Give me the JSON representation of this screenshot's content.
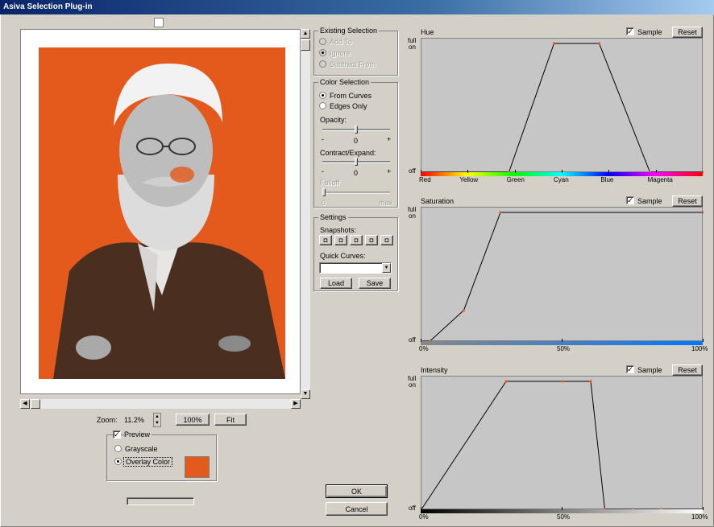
{
  "window": {
    "title": "Asiva Selection Plug-in"
  },
  "preview": {
    "zoom_label": "Zoom:",
    "zoom_value": "11.2%",
    "zoom_100": "100%",
    "zoom_fit": "Fit",
    "preview_label": "Preview",
    "preview_checked": true,
    "grayscale_label": "Grayscale",
    "overlay_label": "Overlay Color",
    "overlay_color": "#e35a1c"
  },
  "existing_selection": {
    "title": "Existing Selection",
    "add_to": "Add To",
    "ignore": "Ignore",
    "subtract_from": "Subtract From"
  },
  "color_selection": {
    "title": "Color Selection",
    "from_curves": "From Curves",
    "edges_only": "Edges Only",
    "opacity_label": "Opacity:",
    "opacity_value": "0",
    "contract_label": "Contract/Expand:",
    "contract_value": "0",
    "falloff_label": "Falloff",
    "falloff_min": "0",
    "falloff_max": "max",
    "minus": "-",
    "plus": "+"
  },
  "settings": {
    "title": "Settings",
    "snapshots_label": "Snapshots:",
    "quick_curves_label": "Quick Curves:",
    "load": "Load",
    "save": "Save"
  },
  "dialog": {
    "ok": "OK",
    "cancel": "Cancel"
  },
  "curves": {
    "sample_label": "Sample",
    "reset_label": "Reset",
    "full_label": "full",
    "on_label": "on",
    "off_label": "off"
  },
  "chart_data": [
    {
      "type": "line",
      "title": "Hue",
      "x_axis": "hue",
      "tick_labels": [
        "Red",
        "Yellow",
        "Green",
        "Cyan",
        "Blue",
        "Magenta"
      ],
      "tick_positions": [
        0.0,
        0.1667,
        0.3333,
        0.5,
        0.6667,
        0.8333
      ],
      "points": [
        [
          0.0,
          0
        ],
        [
          0.31,
          0
        ],
        [
          0.47,
          1
        ],
        [
          0.63,
          1
        ],
        [
          0.81,
          0
        ],
        [
          1.0,
          0
        ]
      ],
      "ylim": [
        0,
        1
      ],
      "sample_checked": true
    },
    {
      "type": "line",
      "title": "Saturation",
      "x_axis": "saturation",
      "tick_labels": [
        "0%",
        "50%",
        "100%"
      ],
      "tick_positions": [
        0.0,
        0.5,
        1.0
      ],
      "points": [
        [
          0.0,
          0
        ],
        [
          0.03,
          0
        ],
        [
          0.15,
          0.24
        ],
        [
          0.28,
          1
        ],
        [
          1.0,
          1
        ]
      ],
      "ylim": [
        0,
        1
      ],
      "sample_checked": true
    },
    {
      "type": "line",
      "title": "Intensity",
      "x_axis": "intensity",
      "tick_labels": [
        "0%",
        "50%",
        "100%"
      ],
      "tick_positions": [
        0.0,
        0.5,
        1.0
      ],
      "points": [
        [
          0.0,
          0
        ],
        [
          0.3,
          1
        ],
        [
          0.5,
          1
        ],
        [
          0.6,
          1
        ],
        [
          0.65,
          0
        ],
        [
          0.75,
          0
        ],
        [
          0.85,
          0
        ],
        [
          1.0,
          0
        ]
      ],
      "ylim": [
        0,
        1
      ],
      "sample_checked": true
    }
  ]
}
